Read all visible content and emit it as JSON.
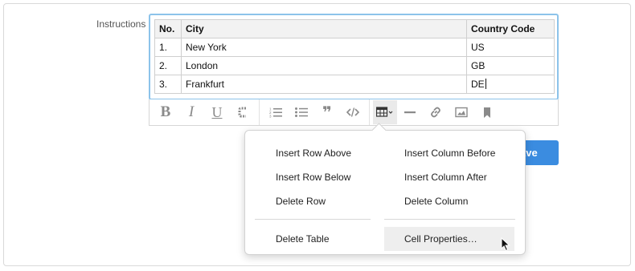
{
  "form": {
    "field_label": "Instructions",
    "save_label": "Save"
  },
  "table": {
    "headers": [
      "No.",
      "City",
      "Country Code"
    ],
    "rows": [
      [
        "1.",
        "New York",
        "US"
      ],
      [
        "2.",
        "London",
        "GB"
      ],
      [
        "3.",
        "Frankfurt",
        "DE"
      ]
    ]
  },
  "toolbar": {
    "buttons": [
      {
        "name": "bold",
        "glyph": "B"
      },
      {
        "name": "italic",
        "glyph": "I"
      },
      {
        "name": "underline",
        "glyph": "U"
      },
      {
        "name": "strikethrough-code",
        "glyph": "C"
      },
      {
        "name": "ordered-list"
      },
      {
        "name": "bullet-list"
      },
      {
        "name": "blockquote",
        "glyph": "❞"
      },
      {
        "name": "code"
      },
      {
        "name": "table"
      },
      {
        "name": "horizontal-rule"
      },
      {
        "name": "link"
      },
      {
        "name": "image"
      },
      {
        "name": "bookmark"
      }
    ]
  },
  "table_menu": {
    "left": [
      "Insert Row Above",
      "Insert Row Below",
      "Delete Row",
      "Delete Table"
    ],
    "right": [
      "Insert Column Before",
      "Insert Column After",
      "Delete Column",
      "Cell Properties…"
    ],
    "highlighted": "Cell Properties…"
  },
  "colors": {
    "focus_border": "#8cc3ea",
    "save_button": "#3b8ce0",
    "icon_gray": "#8a8a8a"
  }
}
